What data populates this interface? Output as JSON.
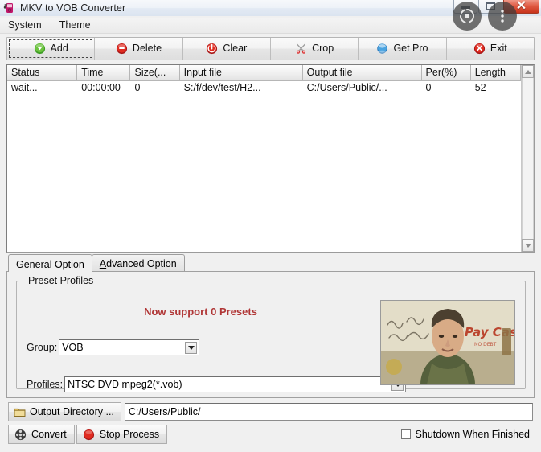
{
  "window": {
    "title": "MKV to VOB Converter",
    "app_icon": "ipod-device-icon",
    "controls": {
      "minimize": "minimize-button",
      "maximize": "maximize-button",
      "close": "close-button",
      "close_glyph": "✕"
    }
  },
  "overlay_buttons": [
    {
      "name": "screenshot-capture-button",
      "icon": "capture-reticle-icon"
    },
    {
      "name": "more-options-button",
      "icon": "three-dots-vertical-icon"
    }
  ],
  "menubar": {
    "items": [
      {
        "label": "System",
        "name": "menu-system"
      },
      {
        "label": "Theme",
        "name": "menu-theme"
      }
    ]
  },
  "toolbar": {
    "buttons": [
      {
        "label": "Add",
        "icon": "green-add-icon",
        "name": "add-button",
        "focused": true
      },
      {
        "label": "Delete",
        "icon": "red-minus-icon",
        "name": "delete-button",
        "focused": false
      },
      {
        "label": "Clear",
        "icon": "red-clear-icon",
        "name": "clear-button",
        "focused": false
      },
      {
        "label": "Crop",
        "icon": "crop-scissors-icon",
        "name": "crop-button",
        "focused": false
      },
      {
        "label": "Get Pro",
        "icon": "blue-orb-icon",
        "name": "getpro-button",
        "focused": false
      },
      {
        "label": "Exit",
        "icon": "red-exit-icon",
        "name": "exit-button",
        "focused": false
      }
    ]
  },
  "filelist": {
    "columns": [
      "Status",
      "Time",
      "Size(...",
      "Input file",
      "Output file",
      "Per(%)",
      "Length"
    ],
    "rows": [
      {
        "status": "wait...",
        "time": "00:00:00",
        "size": "0",
        "input_file": "S:/f/dev/test/H2...",
        "output_file": "C:/Users/Public/...",
        "percent": "0",
        "length": "52"
      }
    ]
  },
  "tabs": [
    {
      "label": "General Option",
      "mnemonic": "G",
      "active": true,
      "name": "tab-general-option"
    },
    {
      "label": "Advanced Option",
      "mnemonic": "A",
      "active": false,
      "name": "tab-advanced-option"
    }
  ],
  "general_option": {
    "groupbox_title": "Preset Profiles",
    "presets_message": "Now support 0 Presets",
    "presets_message_color": "#b03636",
    "group_label": "Group:",
    "group_value": "VOB",
    "profiles_label": "Profiles:",
    "profiles_value": "NTSC DVD mpeg2(*.vob)",
    "preview_alt": "video-preview-thumbnail"
  },
  "bottom": {
    "output_dir_button": "Output Directory ...",
    "output_dir_icon": "folder-icon",
    "output_dir_value": "C:/Users/Public/",
    "convert_button": "Convert",
    "convert_icon": "film-reel-icon",
    "stop_button": "Stop Process",
    "stop_icon": "red-stop-circle-icon",
    "shutdown_label": "Shutdown When Finished",
    "shutdown_checked": false
  }
}
